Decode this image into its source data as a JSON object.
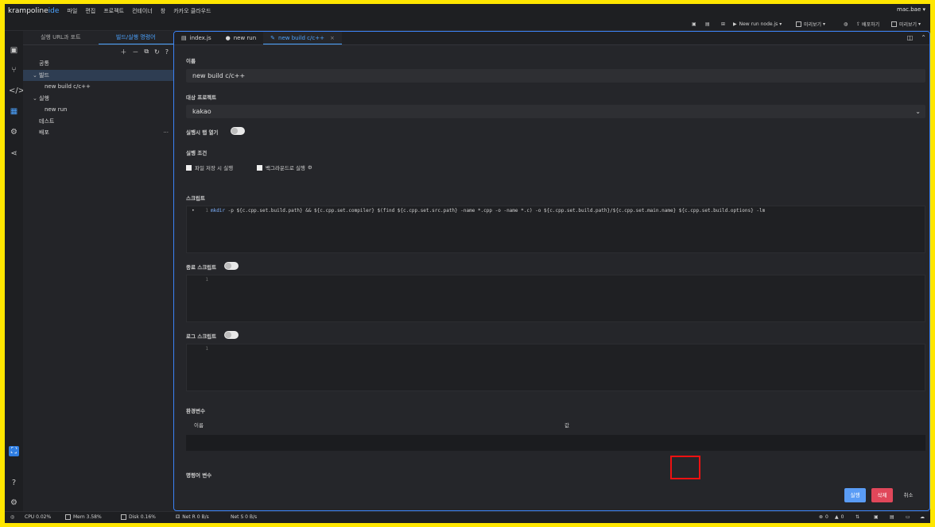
{
  "menubar": {
    "logo_main": "krampoline",
    "logo_ide": "ide",
    "menus": [
      "파일",
      "편집",
      "프로젝트",
      "컨테이너",
      "창",
      "카카오 클라우드"
    ],
    "user": "mac.bae ▾"
  },
  "toolbar": {
    "run_config": "New run node.js",
    "preview1": "미리보기",
    "deploy": "배포하기",
    "preview2": "미리보기"
  },
  "sidebar": {
    "tabs": [
      "실행 URL과 포트",
      "빌드/실행 명령어"
    ],
    "tree": [
      {
        "label": "공통",
        "level": 0,
        "chevron": ""
      },
      {
        "label": "빌드",
        "level": 0,
        "chevron": "⌄",
        "selected": true
      },
      {
        "label": "new build c/c++",
        "level": 1,
        "chevron": ""
      },
      {
        "label": "실행",
        "level": 0,
        "chevron": "⌄"
      },
      {
        "label": "new run",
        "level": 1,
        "chevron": ""
      },
      {
        "label": "테스트",
        "level": 0,
        "chevron": ""
      },
      {
        "label": "배포",
        "level": 0,
        "chevron": "",
        "more": "···"
      }
    ]
  },
  "editor_tabs": [
    {
      "label": "index.js",
      "icon": "file-icon"
    },
    {
      "label": "new run",
      "icon": "gear-icon"
    },
    {
      "label": "new build c/c++",
      "icon": "wrench-icon",
      "active": true,
      "close": "×"
    }
  ],
  "form": {
    "name_label": "이름",
    "name_value": "new build c/c++",
    "project_label": "대상 프로젝트",
    "project_value": "kakao",
    "open_tab_label": "실행시 탭 열기",
    "run_condition_label": "실행 조건",
    "on_save_label": "파일 저장 시 실행",
    "background_label": "백그라운드로 실행",
    "script_label": "스크립트",
    "script_line_no": "1",
    "script_code_cmd": "mkdir",
    "script_code_rest": " -p ${c.cpp.set.build.path} && ${c.cpp.set.compiler} $(find ${c.cpp.set.src.path} -name *.cpp -o -name *.c) -o ${c.cpp.set.build.path}/${c.cpp.set.main.name} ${c.cpp.set.build.options} -lm",
    "end_script_label": "종료 스크립트",
    "end_line_no": "1",
    "log_script_label": "로그 스크립트",
    "log_line_no": "1",
    "env_label": "환경변수",
    "env_col_name": "이름",
    "env_col_value": "값",
    "cmd_var_label": "명령어 변수"
  },
  "buttons": {
    "run": "실행",
    "delete": "삭제",
    "cancel": "취소"
  },
  "status": {
    "cpu": "CPU 0.02%",
    "mem": "Mem 3.58%",
    "disk": "Disk 0.16%",
    "net_r": "Net R 0 B/s",
    "net_s": "Net S 0 B/s",
    "errors": "0",
    "warnings": "0"
  },
  "colors": {
    "accent": "#4ca3ff",
    "run_button": "#5a9cf5",
    "delete_button": "#e0475a",
    "highlight": "#ee1111"
  }
}
